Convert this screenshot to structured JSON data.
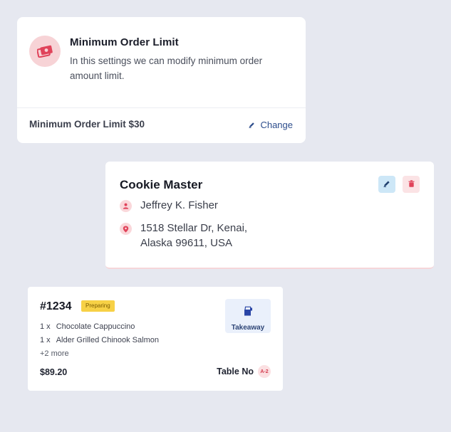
{
  "colors": {
    "background": "#e6e8f0",
    "accent_red": "#e0435a",
    "link_blue": "#2d4d8c",
    "badge_yellow": "#f7d146"
  },
  "limit_card": {
    "title": "Minimum Order Limit",
    "description": "In this settings we can modify minimum order amount limit.",
    "current_value": "Minimum Order Limit $30",
    "change_label": "Change",
    "icon": "money-icon"
  },
  "store_card": {
    "name": "Cookie Master",
    "owner": "Jeffrey K. Fisher",
    "address_line1": "1518 Stellar Dr, Kenai,",
    "address_line2": "Alaska 99611, USA",
    "icons": [
      "user-icon",
      "location-pin-icon",
      "edit-icon",
      "trash-icon"
    ]
  },
  "order_card": {
    "id": "#1234",
    "status": "Preparing",
    "items": [
      {
        "qty": "1 x",
        "name": "Chocolate Cappuccino"
      },
      {
        "qty": "1 x",
        "name": "Alder Grilled Chinook Salmon"
      }
    ],
    "more": "+2 more",
    "total": "$89.20",
    "order_type": "Takeaway",
    "table_label": "Table No",
    "table_number": "A-2"
  }
}
